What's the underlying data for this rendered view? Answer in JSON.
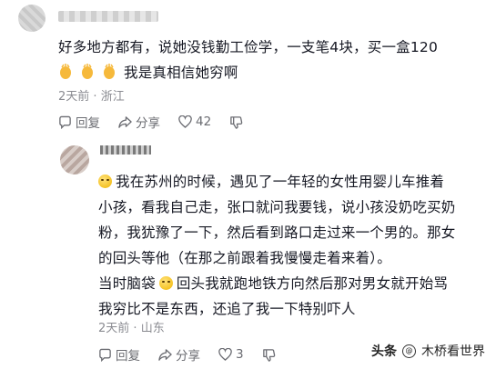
{
  "comment": {
    "text_line1": "好多地方都有，说她没钱勤工俭学，一支笔4块，买一盒120",
    "text_line2": "我是真相信她穷啊",
    "time": "2天前",
    "location": "浙江",
    "actions": {
      "reply": "回复",
      "share": "分享",
      "likes": "42"
    }
  },
  "reply": {
    "lines": [
      "我在苏州的时候，遇见了一年轻的女性用婴儿车推着",
      "小孩，看我自己走，张口就问我要钱，说小孩没奶吃买奶",
      "粉，我犹豫了一下，然后看到路口走过来一个男的。那女",
      "的回头等他（在那之前跟着我慢慢走着来着）。"
    ],
    "line5_prefix": "当时脑袋",
    "line5_suffix": "回头我就跑地铁方向然后那对男女就开始骂",
    "line6": "我穷比不是东西，还追了我一下特别吓人",
    "time": "2天前",
    "location": "山东",
    "actions": {
      "reply": "回复",
      "share": "分享",
      "likes": "3"
    }
  },
  "watermark": {
    "brand": "头条",
    "handle": "木桥看世界"
  },
  "icons": {
    "reply": "chat-bubble-icon",
    "share": "share-arrow-icon",
    "like": "heart-icon",
    "dislike": "thumbs-down-icon"
  }
}
